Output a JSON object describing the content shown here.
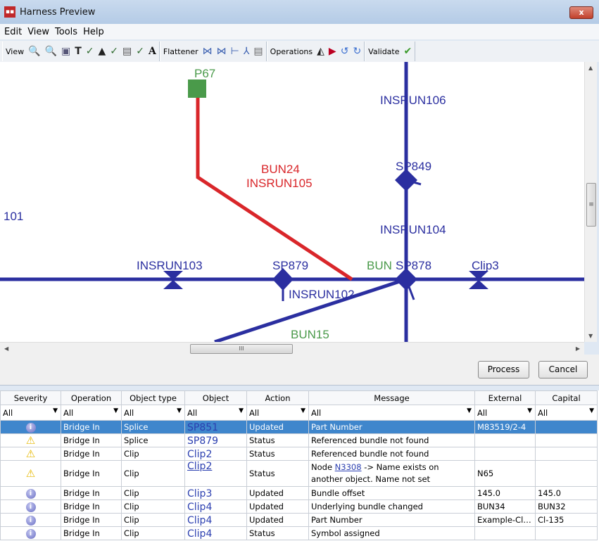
{
  "window": {
    "title": "Harness Preview",
    "close": "x"
  },
  "menu": [
    "Edit",
    "View",
    "Tools",
    "Help"
  ],
  "toolbar": {
    "view": "View",
    "flattener": "Flattener",
    "operations": "Operations",
    "validate": "Validate"
  },
  "diagram": {
    "labels": {
      "p67": "P67",
      "bun24": "BUN24",
      "insrun105": "INSRUN105",
      "insrun106": "INSRUN106",
      "sp849": "SP849",
      "insrun104": "INSRUN104",
      "n101": "101",
      "insrun103": "INSRUN103",
      "sp879": "SP879",
      "bun": "BUN",
      "sp878": "SP878",
      "clip3": "Clip3",
      "insrun102": "INSRUN102",
      "bun15": "BUN15"
    },
    "colors": {
      "wire": "#2b2fa0",
      "highlight": "#d9262a",
      "green": "#4a9a4a"
    }
  },
  "scroll": {
    "thumb": "III",
    "vthumb": "≡"
  },
  "buttons": {
    "process": "Process",
    "cancel": "Cancel"
  },
  "table": {
    "columns": [
      "Severity",
      "Operation",
      "Object type",
      "Object",
      "Action",
      "Message",
      "External",
      "Capital"
    ],
    "filter": "All",
    "rows": [
      {
        "severity": "info",
        "operation": "Bridge In",
        "type": "Splice",
        "object": "SP851",
        "action": "Updated",
        "message": "Part Number",
        "external": "M83519/2-4",
        "capital": "",
        "selected": true
      },
      {
        "severity": "warning",
        "operation": "Bridge In",
        "type": "Splice",
        "object": "SP879",
        "action": "Status",
        "message": "Referenced bundle not found",
        "external": "",
        "capital": ""
      },
      {
        "severity": "warning",
        "operation": "Bridge In",
        "type": "Clip",
        "object": "Clip2",
        "action": "Status",
        "message": "Referenced bundle not found",
        "external": "",
        "capital": ""
      },
      {
        "severity": "warning",
        "operation": "Bridge In",
        "type": "Clip",
        "object": "Clip2",
        "action": "Status",
        "message_pre": "Node ",
        "message_link": "N3308",
        "message_post": " -> Name exists on another object. Name not set",
        "external": "N65",
        "capital": ""
      },
      {
        "severity": "info",
        "operation": "Bridge In",
        "type": "Clip",
        "object": "Clip3",
        "action": "Updated",
        "message": "Bundle offset",
        "external": "145.0",
        "capital": "145.0"
      },
      {
        "severity": "info",
        "operation": "Bridge In",
        "type": "Clip",
        "object": "Clip4",
        "action": "Updated",
        "message": "Underlying bundle changed",
        "external": "BUN34",
        "capital": "BUN32"
      },
      {
        "severity": "info",
        "operation": "Bridge In",
        "type": "Clip",
        "object": "Clip4",
        "action": "Updated",
        "message": "Part Number",
        "external": "Example-Cli...",
        "capital": "Cl-135"
      },
      {
        "severity": "info",
        "operation": "Bridge In",
        "type": "Clip",
        "object": "Clip4",
        "action": "Status",
        "message": "Symbol assigned",
        "external": "",
        "capital": ""
      }
    ]
  }
}
